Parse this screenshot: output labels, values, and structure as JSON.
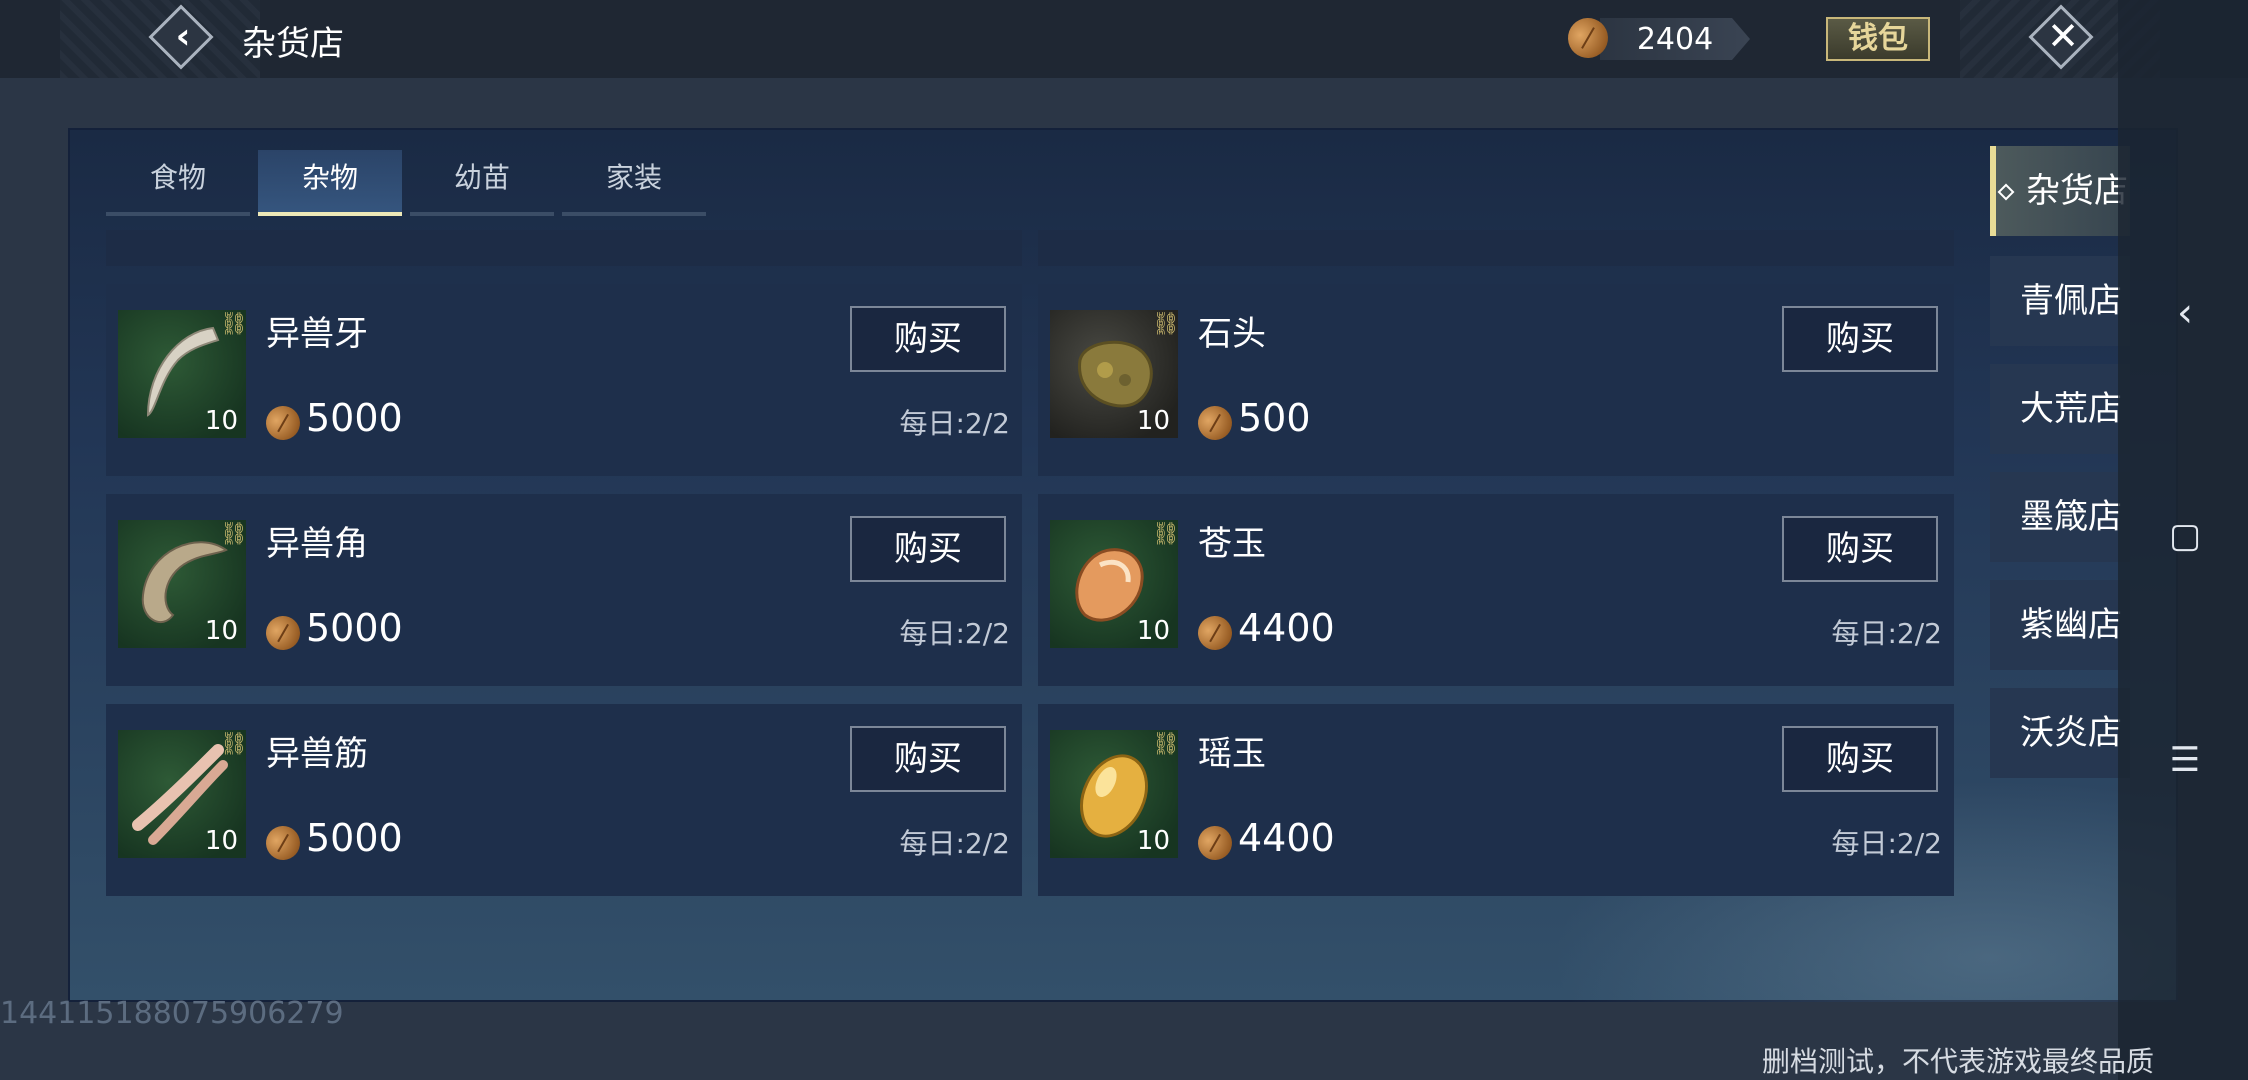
{
  "header": {
    "title": "杂货店",
    "back_icon": "back-arrow-icon",
    "currency_icon": "seed-coin-icon",
    "currency_amount": "2404",
    "wallet_label": "钱包",
    "close_icon": "close-x-icon"
  },
  "tabs": [
    {
      "label": "食物",
      "active": false
    },
    {
      "label": "杂物",
      "active": true
    },
    {
      "label": "幼苗",
      "active": false
    },
    {
      "label": "家装",
      "active": false
    }
  ],
  "items": [
    {
      "name": "异兽牙",
      "qty": "10",
      "price": "5000",
      "buy_label": "购买",
      "limit": "每日:2/2",
      "icon": "beast-tooth-icon"
    },
    {
      "name": "石头",
      "qty": "10",
      "price": "500",
      "buy_label": "购买",
      "limit": "",
      "icon": "stone-icon"
    },
    {
      "name": "异兽角",
      "qty": "10",
      "price": "5000",
      "buy_label": "购买",
      "limit": "每日:2/2",
      "icon": "beast-horn-icon"
    },
    {
      "name": "苍玉",
      "qty": "10",
      "price": "4400",
      "buy_label": "购买",
      "limit": "每日:2/2",
      "icon": "azure-jade-icon"
    },
    {
      "name": "异兽筋",
      "qty": "10",
      "price": "5000",
      "buy_label": "购买",
      "limit": "每日:2/2",
      "icon": "beast-sinew-icon"
    },
    {
      "name": "瑶玉",
      "qty": "10",
      "price": "4400",
      "buy_label": "购买",
      "limit": "每日:2/2",
      "icon": "yao-jade-icon"
    }
  ],
  "shops": [
    {
      "label": "杂货店",
      "active": true
    },
    {
      "label": "青佩店",
      "active": false
    },
    {
      "label": "大荒店",
      "active": false
    },
    {
      "label": "墨箴店",
      "active": false
    },
    {
      "label": "紫幽店",
      "active": false
    },
    {
      "label": "沃炎店",
      "active": false
    }
  ],
  "system_nav": {
    "back_icon": "chevron-left-icon",
    "home_icon": "square-home-icon",
    "menu_icon": "hamburger-menu-icon"
  },
  "footer": {
    "build_id": "14411518807590627­9",
    "disclaimer": "删档测试，不代表游戏最终品质"
  },
  "colors": {
    "accent_gold": "#e8dc96",
    "panel_blue": "#1a2a44",
    "coin_brown": "#9a5f26"
  }
}
